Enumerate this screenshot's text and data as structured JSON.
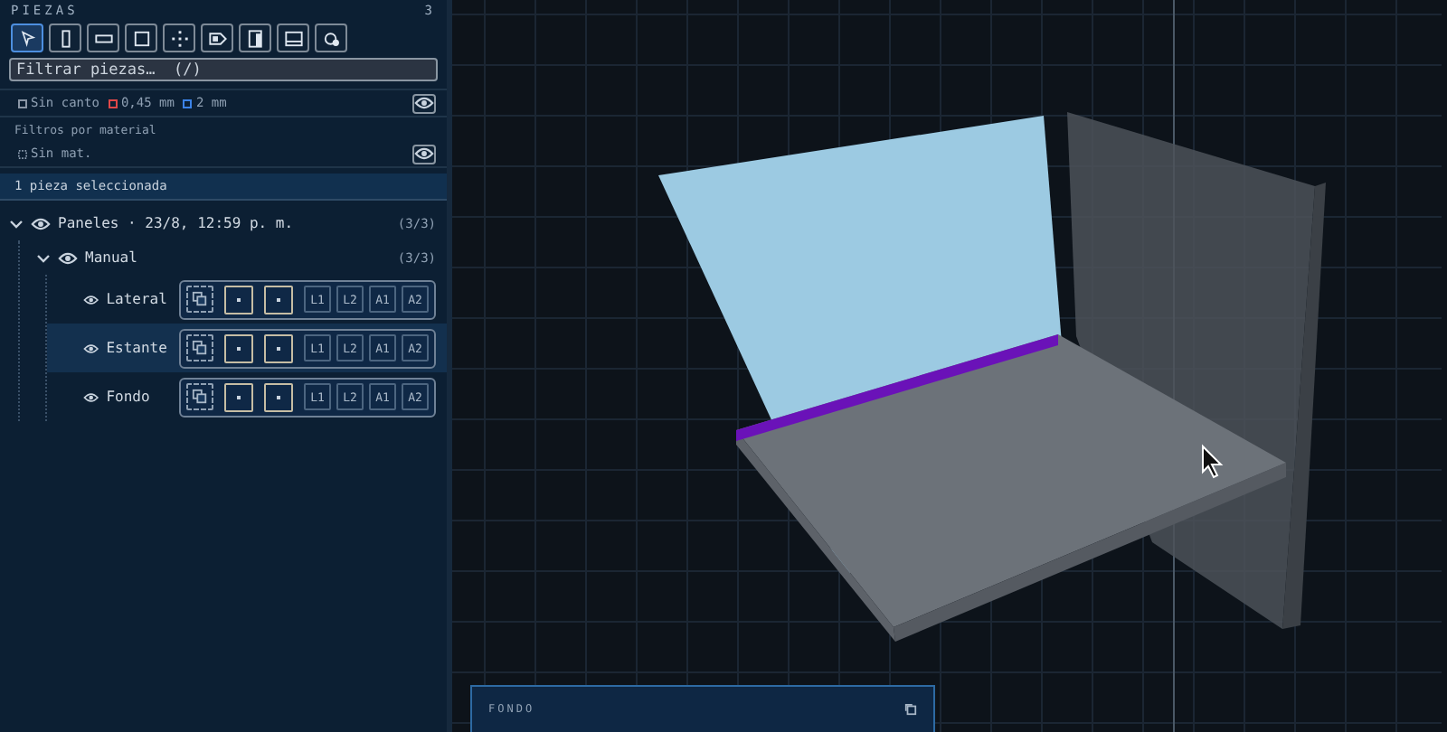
{
  "panel": {
    "title": "PIEZAS",
    "count": "3"
  },
  "tools": [
    {
      "kind": "pointer",
      "selected": true
    },
    {
      "kind": "vertical",
      "selected": false
    },
    {
      "kind": "horizontal",
      "selected": false
    },
    {
      "kind": "square",
      "selected": false
    },
    {
      "kind": "move",
      "selected": false
    },
    {
      "kind": "tag",
      "selected": false
    },
    {
      "kind": "door",
      "selected": false
    },
    {
      "kind": "frame",
      "selected": false
    },
    {
      "kind": "cog",
      "selected": false
    }
  ],
  "search": {
    "placeholder": "Filtrar piezas…  (/)"
  },
  "edge_filters": [
    {
      "label": "Sin canto",
      "color": "#8a96a6"
    },
    {
      "label": "0,45 mm",
      "color": "#e04848"
    },
    {
      "label": "2 mm",
      "color": "#3b82e6"
    }
  ],
  "material_filters": {
    "title": "Filtros por material",
    "items": [
      {
        "label": "Sin mat."
      }
    ]
  },
  "selection_status": "1 pieza seleccionada",
  "tree": [
    {
      "label": "Paneles · 23/8, 12:59 p. m.",
      "count": "(3/3)",
      "expanded": true,
      "children": [
        {
          "label": "Manual",
          "count": "(3/3)",
          "expanded": true,
          "children": [
            {
              "label": "Lateral",
              "selected": false,
              "edge_buttons": [
                "L1",
                "L2",
                "A1",
                "A2"
              ]
            },
            {
              "label": "Estante",
              "selected": true,
              "edge_buttons": [
                "L1",
                "L2",
                "A1",
                "A2"
              ]
            },
            {
              "label": "Fondo",
              "selected": false,
              "edge_buttons": [
                "L1",
                "L2",
                "A1",
                "A2"
              ]
            }
          ]
        }
      ]
    }
  ],
  "detail_card": {
    "title": "FONDO"
  }
}
